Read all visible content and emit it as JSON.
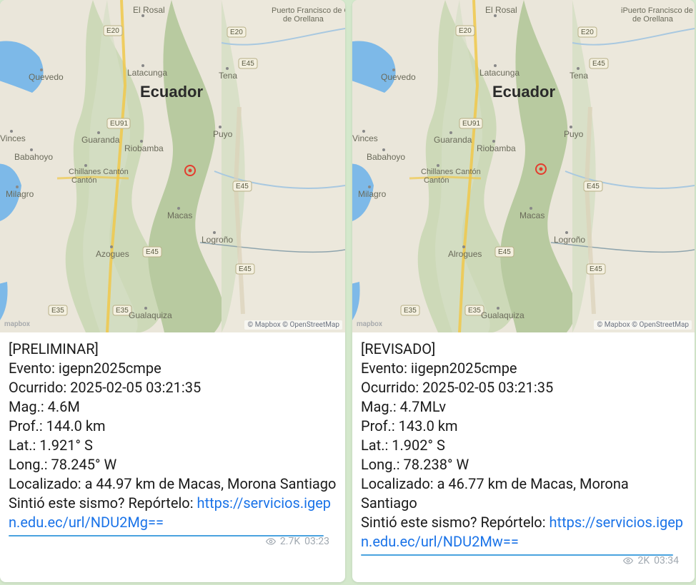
{
  "cards": [
    {
      "status": "[PRELIMINAR]",
      "event_label": "Evento:",
      "event_value": "igepn2025cmpe",
      "occurred_label": "Ocurrido:",
      "occurred_value": "2025-02-05 03:21:35",
      "mag_label": "Mag.:",
      "mag_value": "4.6M",
      "prof_label": "Prof.:",
      "prof_value": "144.0 km",
      "lat_label": "Lat.:",
      "lat_value": "1.921° S",
      "long_label": "Long.:",
      "long_value": "78.245° W",
      "loc_label": "Localizado:",
      "loc_value": "a 44.97 km de Macas, Morona Santiago",
      "prompt": "Sintió este sismo? Repórtelo:",
      "link_text": "https://servicios.igepn.edu.ec/url/NDU2Mg==",
      "views": "2.7K",
      "time": "03:23",
      "map_attribution": "© Mapbox © OpenStreetMap",
      "map_badge": "mapbox",
      "country_label": "Ecuador",
      "cities": {
        "el_rosal": "El Rosal",
        "pf_orellana": "Puerto Francisco de Orellana",
        "latacunga": "Latacunga",
        "tena": "Tena",
        "quevedo": "Quevedo",
        "guaranda": "Guaranda",
        "riobamba": "Riobamba",
        "puyo": "Puyo",
        "babahoyo": "Babahoyo",
        "chillanes": "Chillanes Cantón",
        "vinces": "Vinces",
        "milagro": "Milagro",
        "macas": "Macas",
        "azogues": "Azogues",
        "logrono": "Logroño",
        "gualaquiza": "Gualaquiza"
      },
      "routes": {
        "e20": "E20",
        "e45": "E45",
        "eu91": "EU91",
        "e35": "E35"
      }
    },
    {
      "status": "[REVISADO]",
      "event_label": "Evento:",
      "event_value": "iigepn2025cmpe",
      "occurred_label": "Ocurrido:",
      "occurred_value": "2025-02-05 03:21:35",
      "mag_label": "Mag.:",
      "mag_value": "4.7MLv",
      "prof_label": "Prof.:",
      "prof_value": "143.0 km",
      "lat_label": "Lat.:",
      "lat_value": "1.902° S",
      "long_label": "Long.:",
      "long_value": "78.238° W",
      "loc_label": "Localizado:",
      "loc_value": "a 46.77 km de Macas, Morona Santiago",
      "prompt": "Sintió este sismo? Repórtelo:",
      "link_text": "https://servicios.igepn.edu.ec/url/NDU2Mw==",
      "views": "2K",
      "time": "03:34",
      "map_attribution": "© Mapbox © OpenStreetMap",
      "map_badge": "mapbox",
      "country_label": "Ecuador",
      "cities": {
        "el_rosal": "El Rosal",
        "pf_orellana": "iPuerto Francisco de Orellana",
        "latacunga": "Latacunga",
        "tena": "Tena",
        "quevedo": "Quevedo",
        "guaranda": "Guaranda",
        "riobamba": "Riobamba",
        "puyo": "Puyo",
        "babahoyo": "Babahoyo",
        "chillanes": "Chillanes Cantón",
        "vinces": "Vinces",
        "milagro": "Milagro",
        "macas": "Macas",
        "azogues": "Alrogues",
        "logrono": "Logroño",
        "gualaquiza": "Gualaquiza"
      },
      "routes": {
        "e20": "E20",
        "e45": "E45",
        "eu91": "EU91",
        "e35": "E35"
      }
    }
  ]
}
